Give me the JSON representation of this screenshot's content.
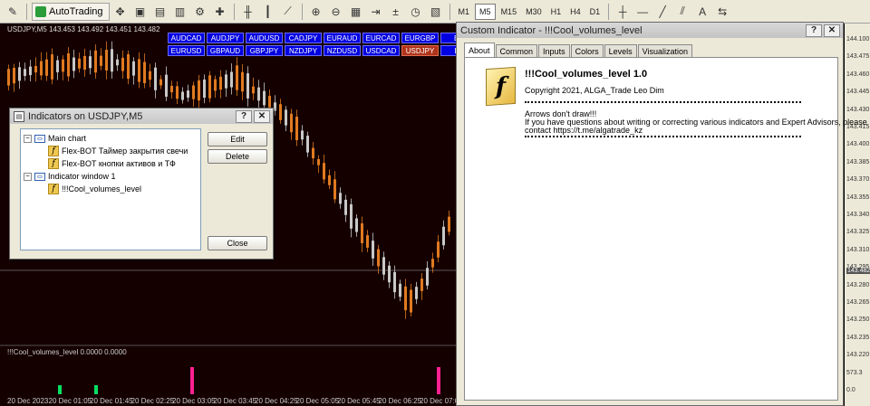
{
  "toolbar": {
    "autotrading_label": "AutoTrading",
    "timeframes": [
      "M1",
      "M5",
      "M15",
      "M30",
      "H1",
      "H4",
      "D1"
    ],
    "active_timeframe": "M5"
  },
  "chart": {
    "title": "USDJPY,M5  143.453 143.492 143.451 143.482",
    "symbols": [
      "AUDCAD",
      "AUDJPY",
      "AUDUSD",
      "CADJPY",
      "EURAUD",
      "EURCAD",
      "EURGBP",
      "EU",
      "EURUSD",
      "GBPAUD",
      "GBPJPY",
      "NZDJPY",
      "NZDUSD",
      "USDCAD",
      "USDJPY",
      "BT"
    ],
    "active_symbol": "USDJPY",
    "indicator_label": "!!!Cool_volumes_level 0.0000 0.0000",
    "time_ticks": [
      "20 Dec 2023",
      "20 Dec 01:05",
      "20 Dec 01:45",
      "20 Dec 02:25",
      "20 Dec 03:05",
      "20 Dec 03:45",
      "20 Dec 04:25",
      "20 Dec 05:05",
      "20 Dec 05:45",
      "20 Dec 06:25",
      "20 Dec 07:05"
    ],
    "bull_color": "#c8c8c8",
    "bear_color": "#e07a20",
    "background_color": "#150000"
  },
  "price_axis": {
    "labels": [
      "144.100",
      "143.475",
      "143.460",
      "143.445",
      "143.430",
      "143.415",
      "143.400",
      "143.385",
      "143.370",
      "143.355",
      "143.340",
      "143.325",
      "143.310",
      "143.295",
      "143.280",
      "143.265",
      "143.250",
      "143.235",
      "143.220",
      "573.3",
      "0.0"
    ],
    "current": "143.482"
  },
  "indicators_dialog": {
    "title": "Indicators on USDJPY,M5",
    "tree": {
      "main_chart": "Main chart",
      "main_items": [
        "Flex-BOT Таймер закрытия свечи",
        "Flex-BOT кнопки активов и ТФ"
      ],
      "window": "Indicator window 1",
      "window_items": [
        "!!!Cool_volumes_level"
      ]
    },
    "buttons": {
      "edit": "Edit",
      "delete": "Delete",
      "close": "Close"
    }
  },
  "custom_indicator_dialog": {
    "title": "Custom Indicator - !!!Cool_volumes_level",
    "tabs": [
      "About",
      "Common",
      "Inputs",
      "Colors",
      "Levels",
      "Visualization"
    ],
    "active_tab": "About",
    "about": {
      "name": "!!!Cool_volumes_level 1.0",
      "copyright": "Copyright 2021, ALGA_Trade Leo Dim",
      "line1": "Arrows don't draw!!!",
      "line2": "If you have questions about writing or correcting various indicators and Expert Advisors, please",
      "line3": "contact https://t.me/algatrade_kz"
    }
  }
}
